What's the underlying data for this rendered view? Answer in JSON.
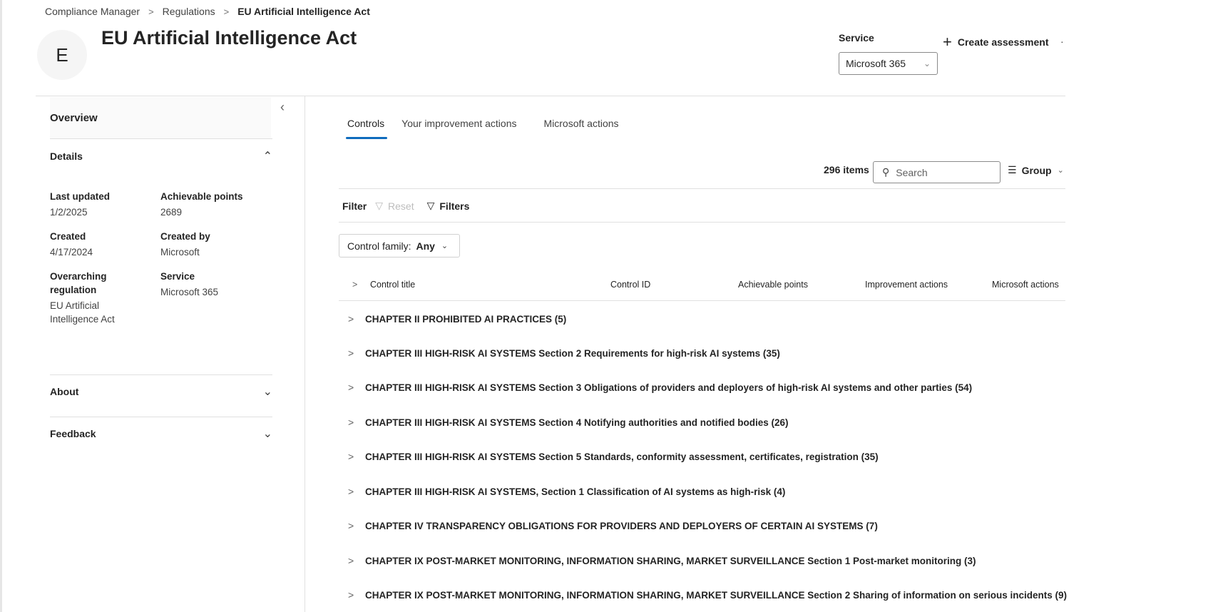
{
  "breadcrumb": {
    "items": [
      "Compliance Manager",
      "Regulations"
    ],
    "current": "EU Artificial Intelligence Act"
  },
  "header": {
    "avatar_letter": "E",
    "title": "EU Artificial Intelligence Act",
    "service_label": "Service",
    "service_value": "Microsoft 365",
    "create_label": "Create assessment",
    "more": "·"
  },
  "sidebar": {
    "overview": "Overview",
    "details_label": "Details",
    "details": {
      "last_updated_k": "Last updated",
      "last_updated_v": "1/2/2025",
      "achievable_k": "Achievable points",
      "achievable_v": "2689",
      "created_k": "Created",
      "created_v": "4/17/2024",
      "created_by_k": "Created by",
      "created_by_v": "Microsoft",
      "overarching_k1": "Overarching",
      "overarching_k2": "regulation",
      "overarching_v1": "EU Artificial",
      "overarching_v2": "Intelligence Act",
      "service_k": "Service",
      "service_v": "Microsoft 365"
    },
    "about": "About",
    "feedback": "Feedback"
  },
  "tabs": [
    "Controls",
    "Your improvement actions",
    "Microsoft actions"
  ],
  "toolbar": {
    "items_count": "296 items",
    "search_placeholder": "Search",
    "group": "Group"
  },
  "filter": {
    "label": "Filter",
    "reset": "Reset",
    "filters": "Filters",
    "family_label": "Control family:",
    "family_value": "Any"
  },
  "table": {
    "columns": [
      "Control title",
      "Control ID",
      "Achievable points",
      "Improvement actions",
      "Microsoft actions"
    ],
    "rows": [
      "CHAPTER II PROHIBITED AI PRACTICES (5)",
      "CHAPTER III HIGH-RISK AI SYSTEMS Section 2 Requirements for high-risk AI systems (35)",
      "CHAPTER III HIGH-RISK AI SYSTEMS Section 3 Obligations of providers and deployers of high-risk AI systems and other parties (54)",
      "CHAPTER III HIGH-RISK AI SYSTEMS Section 4 Notifying authorities and notified bodies (26)",
      "CHAPTER III HIGH-RISK AI SYSTEMS Section 5 Standards, conformity assessment, certificates, registration (35)",
      "CHAPTER III HIGH-RISK AI SYSTEMS, Section 1 Classification of AI systems as high-risk (4)",
      "CHAPTER IV TRANSPARENCY OBLIGATIONS FOR PROVIDERS AND DEPLOYERS OF CERTAIN AI SYSTEMS (7)",
      "CHAPTER IX POST-MARKET MONITORING, INFORMATION SHARING, MARKET SURVEILLANCE Section 1 Post-market monitoring (3)",
      "CHAPTER IX POST-MARKET MONITORING, INFORMATION SHARING, MARKET SURVEILLANCE Section 2 Sharing of information on serious incidents (9)"
    ]
  },
  "colors": {
    "accent": "#0f6cbd",
    "divider": "#e0e0e0",
    "muted": "#bdbdbd"
  }
}
